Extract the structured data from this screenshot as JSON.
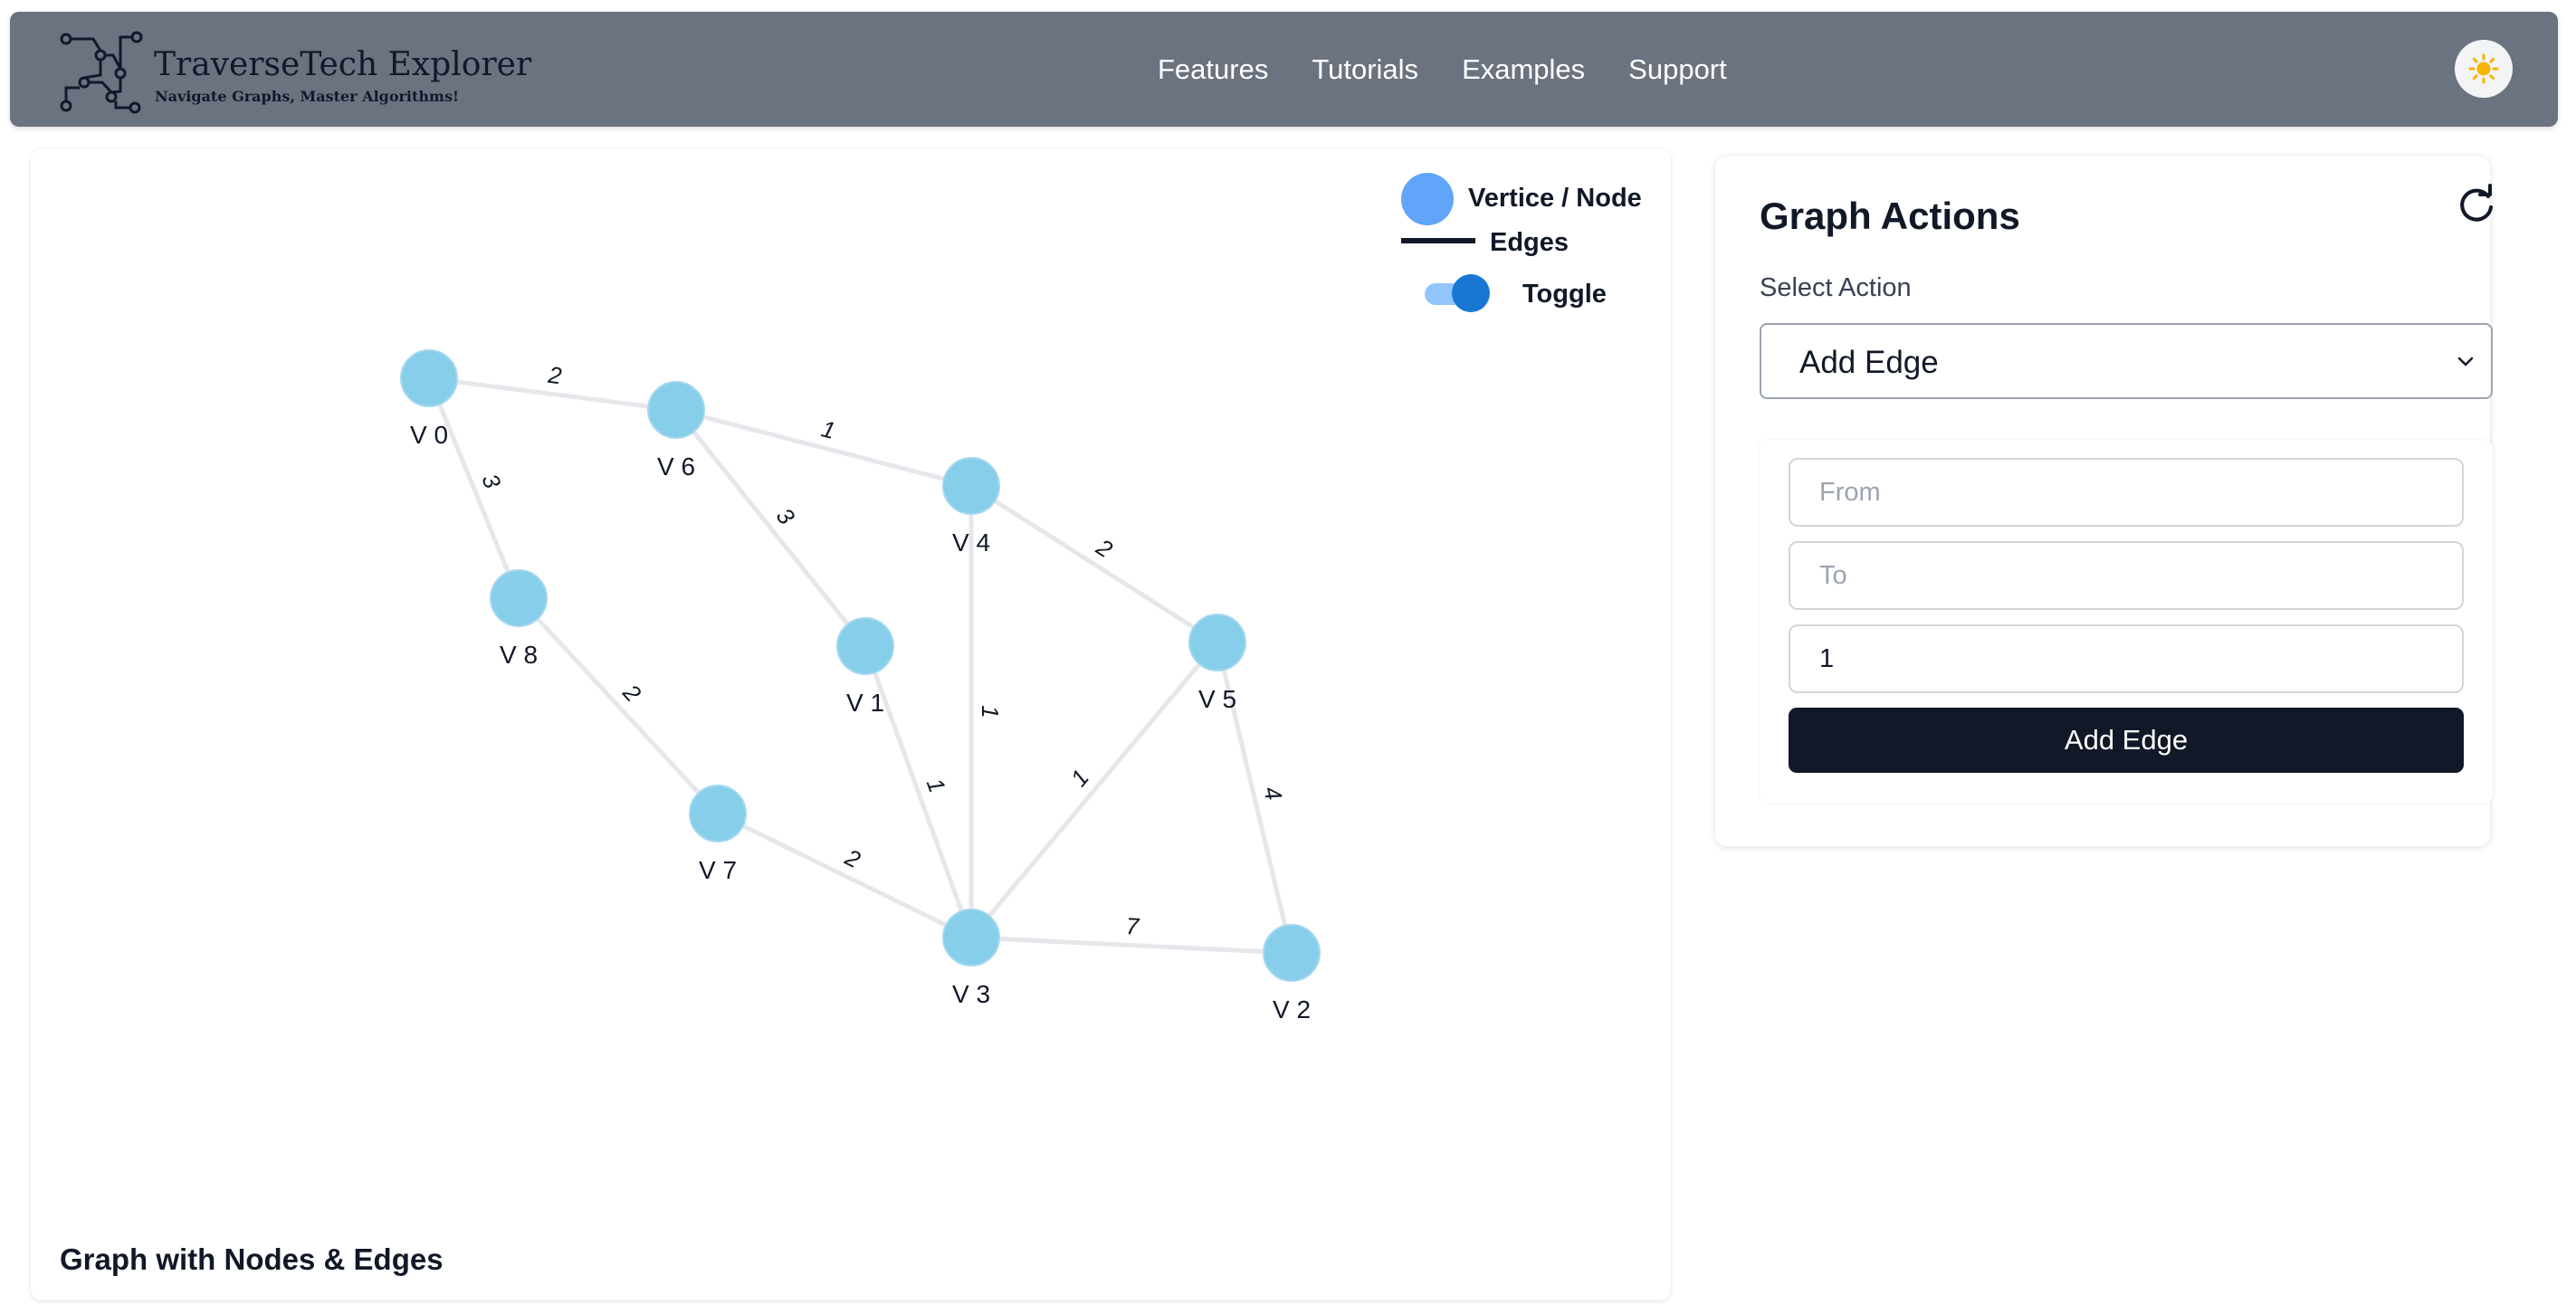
{
  "header": {
    "brand_title": "TraverseTech Explorer",
    "brand_tagline": "Navigate Graphs, Master Algorithms!",
    "nav": [
      "Features",
      "Tutorials",
      "Examples",
      "Support"
    ],
    "theme_icon": "sun-icon",
    "logo_icon": "circuit-graph-logo"
  },
  "graph": {
    "legend": {
      "node_label": "Vertice / Node",
      "edge_label": "Edges",
      "toggle_label": "Toggle",
      "toggle_on": true
    },
    "caption": "Graph with Nodes & Edges",
    "node_color": "#87ceeb",
    "edge_color": "#e5e7eb",
    "nodes": [
      "V 0",
      "V 6",
      "V 4",
      "V 8",
      "V 1",
      "V 5",
      "V 7",
      "V 3",
      "V 2"
    ],
    "edges": [
      {
        "from": "V 0",
        "to": "V 6",
        "weight": "2"
      },
      {
        "from": "V 0",
        "to": "V 8",
        "weight": "3"
      },
      {
        "from": "V 6",
        "to": "V 4",
        "weight": "1"
      },
      {
        "from": "V 6",
        "to": "V 1",
        "weight": "3"
      },
      {
        "from": "V 4",
        "to": "V 5",
        "weight": "2"
      },
      {
        "from": "V 4",
        "to": "V 3",
        "weight": "1"
      },
      {
        "from": "V 8",
        "to": "V 7",
        "weight": "2"
      },
      {
        "from": "V 1",
        "to": "V 3",
        "weight": "1"
      },
      {
        "from": "V 3",
        "to": "V 5",
        "weight": "1"
      },
      {
        "from": "V 5",
        "to": "V 2",
        "weight": "4"
      },
      {
        "from": "V 7",
        "to": "V 3",
        "weight": "2"
      },
      {
        "from": "V 3",
        "to": "V 2",
        "weight": "7"
      }
    ]
  },
  "actions": {
    "title": "Graph Actions",
    "refresh_icon": "refresh-icon",
    "select_label": "Select Action",
    "selected_action": "Add Edge",
    "from_placeholder": "From",
    "to_placeholder": "To",
    "weight_value": "1",
    "submit_label": "Add Edge"
  }
}
